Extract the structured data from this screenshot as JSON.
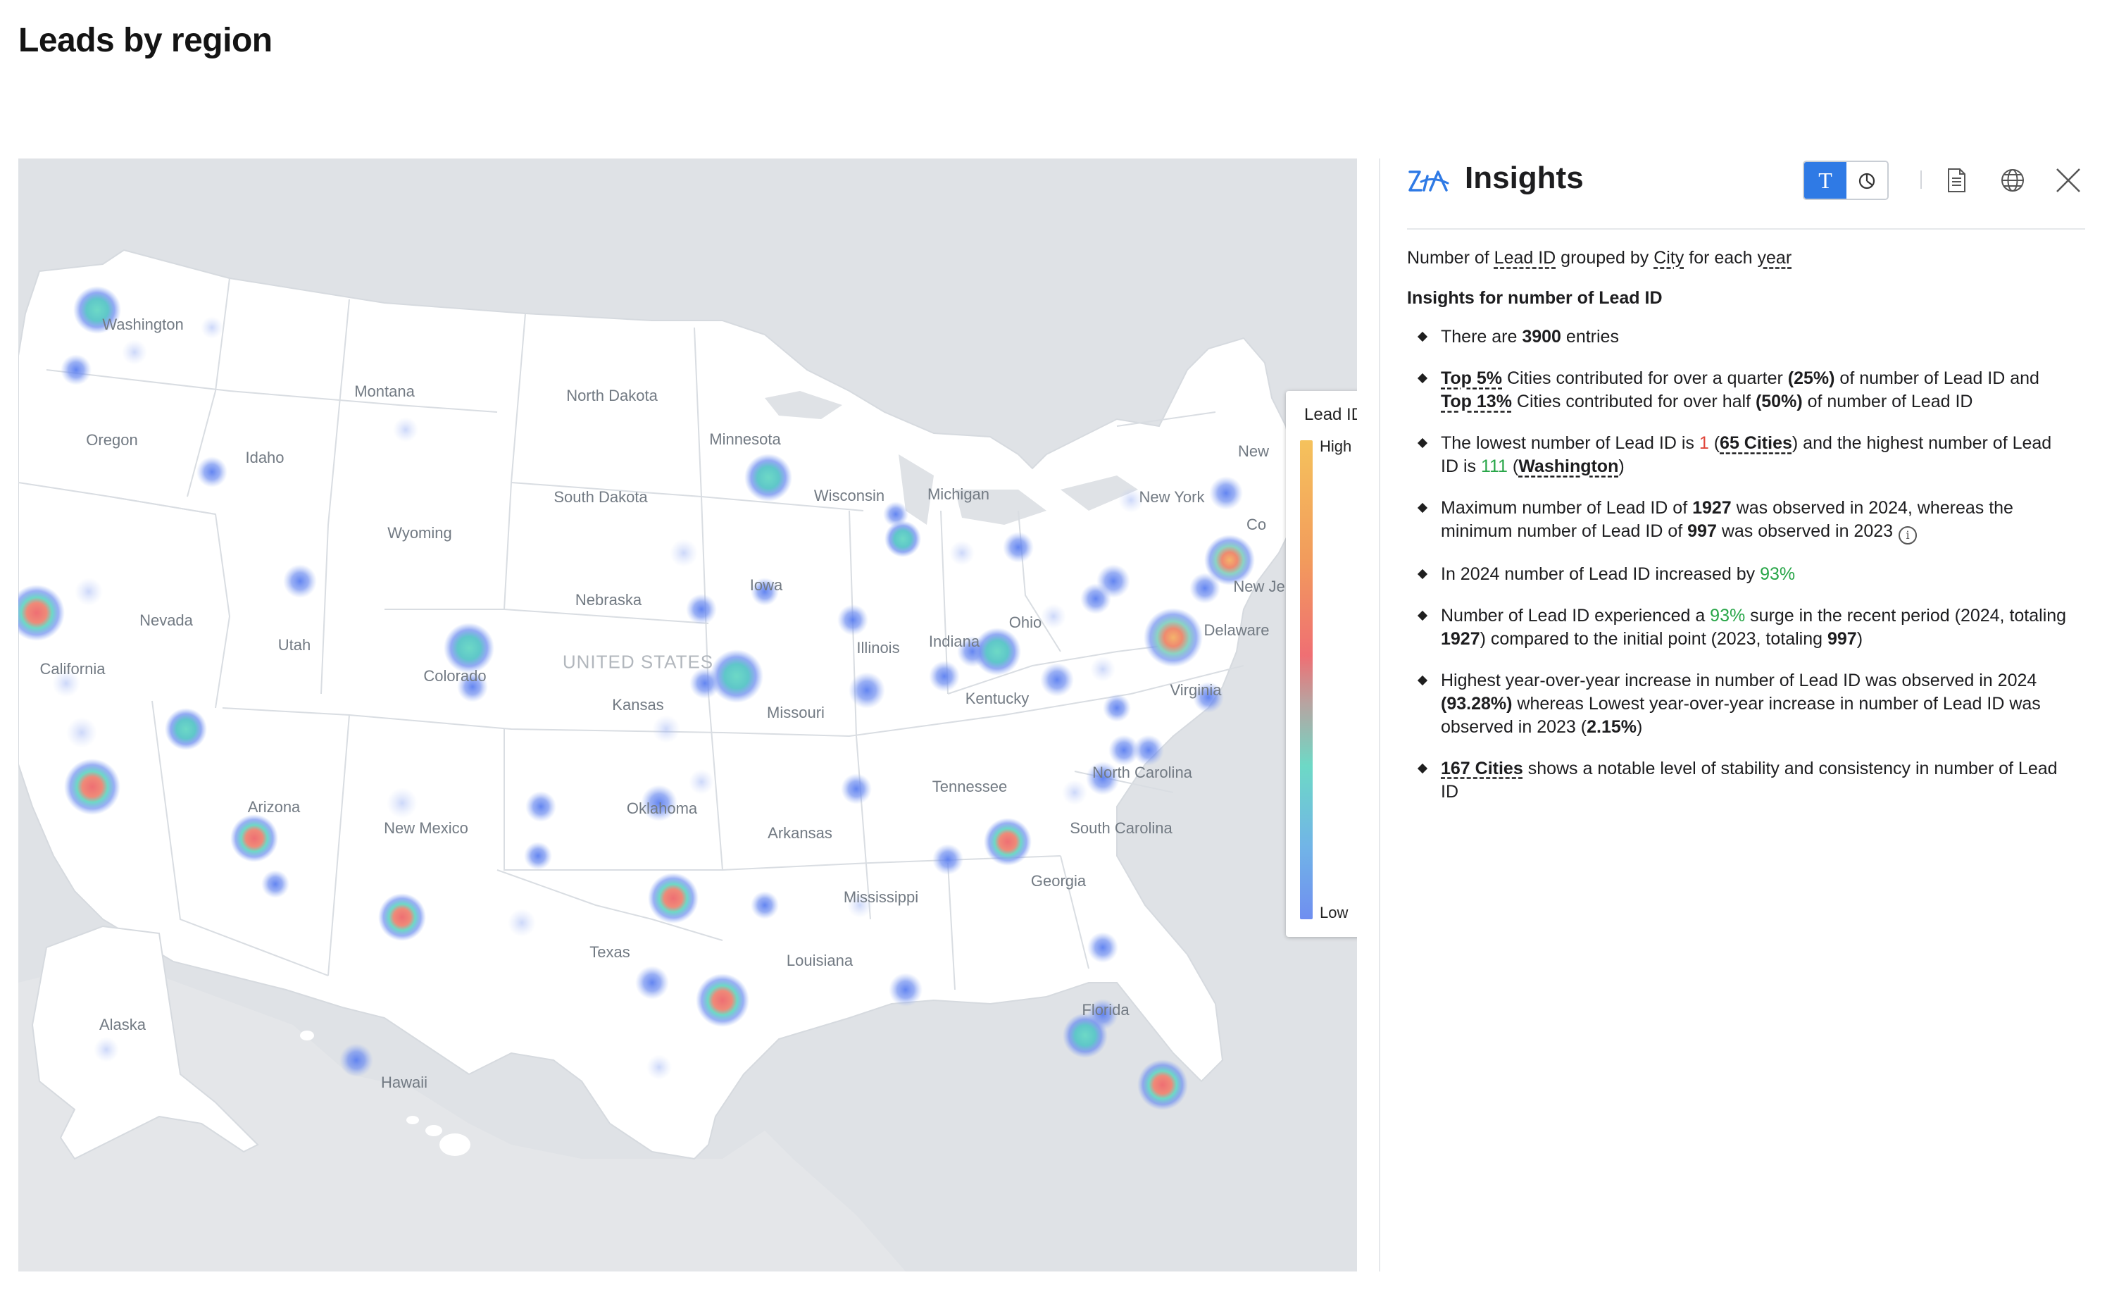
{
  "page": {
    "title": "Leads by region"
  },
  "map": {
    "country_label": "UNITED STATES",
    "legend": {
      "title": "Lead ID",
      "high_label": "High",
      "low_label": "Low",
      "colors": [
        "#f5c25c",
        "#f29b5c",
        "#ef6f73",
        "#6dd9c6",
        "#71b4e7",
        "#6f8ef0"
      ]
    },
    "state_labels": [
      "Washington",
      "Oregon",
      "Idaho",
      "Montana",
      "North Dakota",
      "Minnesota",
      "South Dakota",
      "Wyoming",
      "Nevada",
      "California",
      "Utah",
      "Colorado",
      "Nebraska",
      "Iowa",
      "Kansas",
      "Missouri",
      "Illinois",
      "Indiana",
      "Ohio",
      "Kentucky",
      "Wisconsin",
      "Michigan",
      "New York",
      "Virginia",
      "North Carolina",
      "South Carolina",
      "Georgia",
      "Tennessee",
      "Arkansas",
      "Oklahoma",
      "Texas",
      "Louisiana",
      "Mississippi",
      "Florida",
      "Arizona",
      "New Mexico",
      "Alaska",
      "Hawaii",
      "New",
      "Co",
      "New Je",
      "Delaware"
    ],
    "info_glyph": "i",
    "ocean_color": "#dfe2e6",
    "land_color": "#ffffff"
  },
  "insights": {
    "title": "Insights",
    "icons": [
      "zia-icon",
      "text-view-icon",
      "chart-view-icon",
      "document-icon",
      "globe-icon",
      "close-icon"
    ],
    "toggle_text_glyph": "T",
    "summary": {
      "p1": "Number of ",
      "measure": "Lead ID",
      "p2": " grouped by ",
      "dimension": "City",
      "p3": " for each ",
      "period": "year"
    },
    "subheading": "Insights for number of Lead ID",
    "b1": {
      "p1": "There are ",
      "count": "3900",
      "p2": " entries"
    },
    "b2": {
      "top1": "Top 5%",
      "p1": " Cities contributed for over a quarter ",
      "pct1": "(25%)",
      "p2": " of number of Lead ID and ",
      "top2": "Top 13%",
      "p3": " Cities contributed for over half ",
      "pct2": "(50%)",
      "p4": " of number of Lead ID"
    },
    "b3": {
      "p1": "The lowest number of Lead ID is ",
      "low": "1",
      "p2": " (",
      "low_cities": "65 Cities",
      "p3": ") and the highest number of Lead ID is ",
      "high": "111",
      "p4": " (",
      "high_city": "Washington",
      "p5": ")"
    },
    "b4": {
      "p1": "Maximum number of Lead ID of ",
      "max": "1927",
      "p2": " was observed in 2024, whereas the minimum number of Lead ID of ",
      "min": "997",
      "p3": " was observed in 2023"
    },
    "b5": {
      "p1": "In 2024 number of Lead ID increased by ",
      "pct": "93%"
    },
    "b6": {
      "p1": "Number of Lead ID experienced a ",
      "pct": "93%",
      "p2": " surge in the recent period (2024, totaling ",
      "recent": "1927",
      "p3": ") compared to the initial point (2023, totaling ",
      "initial": "997",
      "p4": ")"
    },
    "b7": {
      "p1": "Highest year-over-year increase in number of Lead ID was observed in 2024 ",
      "high_pct": "(93.28%)",
      "p2": " whereas Lowest year-over-year increase in number of Lead ID was observed in 2023 (",
      "low_pct": "2.15%",
      "p3": ")"
    },
    "b8": {
      "cities": "167 Cities",
      "p1": " shows a notable level of stability and consistency in number of Lead ID"
    }
  }
}
